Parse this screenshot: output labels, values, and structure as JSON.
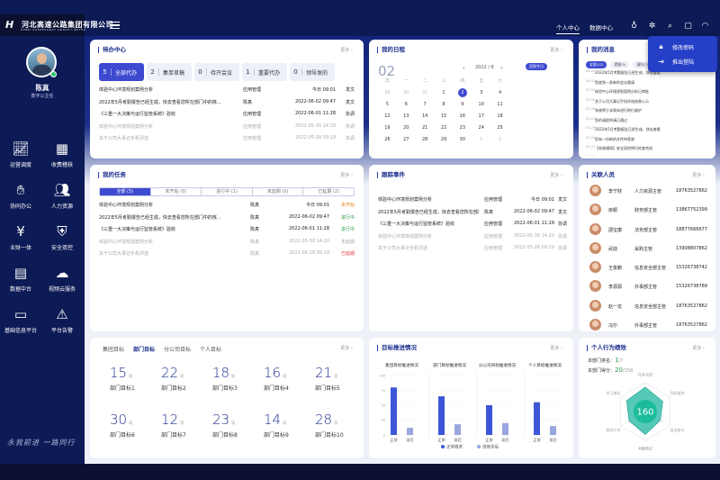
{
  "logo": {
    "name": "河北高速公路集团有限公司",
    "sub": "HEBEI EXPRESSWAY GROUP LIMITED"
  },
  "topnav": {
    "tabs": [
      "个人中心",
      "数据中心"
    ],
    "icons": [
      "bulb-icon",
      "apps-icon",
      "search-icon",
      "message-icon",
      "headset-icon",
      "gear-icon"
    ]
  },
  "user": {
    "name": "陈真",
    "role": "数字公主任"
  },
  "sidebar": {
    "items": [
      {
        "label": "运营调度",
        "icon": "chart-icon"
      },
      {
        "label": "收费稽核",
        "icon": "calculator-icon"
      },
      {
        "label": "协同办公",
        "icon": "handshake-icon"
      },
      {
        "label": "人力资源",
        "icon": "people-icon"
      },
      {
        "label": "业财一体",
        "icon": "money-icon"
      },
      {
        "label": "安全双控",
        "icon": "shield-icon"
      },
      {
        "label": "数据中台",
        "icon": "data-icon"
      },
      {
        "label": "视频云服务",
        "icon": "cloud-play-icon"
      },
      {
        "label": "基础信息平台",
        "icon": "folder-icon"
      },
      {
        "label": "平台告警",
        "icon": "alarm-icon"
      }
    ]
  },
  "signature": "永我前进 一路同行",
  "popup": {
    "items": [
      "修改密码",
      "推出登陆"
    ]
  },
  "todo": {
    "title": "待办中心",
    "more": "更多",
    "tabs": [
      {
        "num": "5",
        "label": "全部代办"
      },
      {
        "num": "2",
        "label": "集单草稿"
      },
      {
        "num": "0",
        "label": "待开会议"
      },
      {
        "num": "1",
        "label": "重要代办"
      },
      {
        "num": "0",
        "label": "领导发的"
      }
    ],
    "rows": [
      {
        "title": "体验中心环境规划案例分析",
        "sys": "应用管理",
        "date": "今日 09:01",
        "status": "发文",
        "dim": false
      },
      {
        "title": "2022年5月考勤报告已经生成，快去查看您所在部门中的核...",
        "sys": "陈真",
        "date": "2022-06-02 09:47",
        "status": "发文",
        "dim": false
      },
      {
        "title": "《三重一大决策与运行监管系统》验收",
        "sys": "应用管理",
        "date": "2022-06-01 11:28",
        "status": "协调",
        "dim": false
      },
      {
        "title": "体验中心环境规划案例分析",
        "sys": "应用管理",
        "date": "2022-05-30 14:20",
        "status": "协调",
        "dim": true
      },
      {
        "title": "关于公司大事记手机评选",
        "sys": "应用管理",
        "date": "2022-05-28 09:19",
        "status": "协调",
        "dim": true
      }
    ]
  },
  "calendar": {
    "title": "我的日程",
    "more": "更多",
    "day": "02",
    "month": "2022 / 6",
    "today_btn": "回到今日",
    "weekdays": [
      "日",
      "一",
      "二",
      "三",
      "四",
      "五",
      "六"
    ],
    "weeks": [
      [
        "29",
        "30",
        "31",
        "1",
        "2",
        "3",
        "4"
      ],
      [
        "5",
        "6",
        "7",
        "8",
        "9",
        "10",
        "11"
      ],
      [
        "12",
        "13",
        "14",
        "15",
        "16",
        "17",
        "18"
      ],
      [
        "19",
        "20",
        "21",
        "22",
        "23",
        "24",
        "25"
      ],
      [
        "26",
        "27",
        "28",
        "29",
        "30",
        "1",
        "2"
      ]
    ],
    "today": "2"
  },
  "messages": {
    "title": "我的消息",
    "more": "更多",
    "tabs": [
      "全部(12)",
      "提醒(5)",
      "通知(7)"
    ],
    "items": [
      {
        "date": "06-02",
        "text": "2022年5月考勤报告已经生成，快去查看"
      },
      {
        "date": "06-01",
        "text": "您收到一条新的会议邀请"
      },
      {
        "date": "05-30",
        "text": "体验中心环境规划案例分析已审批"
      },
      {
        "date": "05-30",
        "text": "关于公司大事记手机评选结果公示"
      },
      {
        "date": "05-28",
        "text": "系统将于本周末进行例行维护"
      },
      {
        "date": "05-27",
        "text": "您的请假申请已通过"
      },
      {
        "date": "05-26",
        "text": "2022年5月考勤报告已经生成，快去查看"
      },
      {
        "date": "05-25",
        "text": "您有一份新的文件待签收"
      },
      {
        "date": "05-24",
        "text": "【系统通知】安全双控例行检查完成"
      },
      {
        "date": "05-22",
        "text": "2022年第一季度绩效考核结果已发布"
      },
      {
        "date": "05-20",
        "text": "关于开展《三重一大决策与运行监管系统》培训"
      },
      {
        "date": "05-19",
        "text": "您的报销单已完成审批"
      }
    ]
  },
  "tasks": {
    "title": "我的任务",
    "more": "更多",
    "segs": [
      "全部 (5)",
      "未开始 (0)",
      "进行中 (1)",
      "未延期 (0)",
      "已延期 (2)"
    ],
    "rows": [
      {
        "title": "体验中心环境规划案例分析",
        "user": "陈真",
        "date": "今日 09:01",
        "status": "未开始",
        "color": "#e0891b",
        "dim": false
      },
      {
        "title": "2022年5月考勤报告已经生成，快去查看您所在部门中的核...",
        "user": "陈真",
        "date": "2022-06-02 09:47",
        "status": "进行中",
        "color": "#2c9b4b",
        "dim": false
      },
      {
        "title": "《三重一大决策与运行监管系统》验收",
        "user": "陈真",
        "date": "2022-06-01 11:28",
        "status": "进行中",
        "color": "#2c9b4b",
        "dim": false
      },
      {
        "title": "体验中心环境规划案例分析",
        "user": "陈真",
        "date": "2022-05-30 14:20",
        "status": "未延期",
        "color": "#888888",
        "dim": true
      },
      {
        "title": "关于公司大事记手机评选",
        "user": "陈真",
        "date": "2022-05-28 09:19",
        "status": "已延期",
        "color": "#e03a3a",
        "dim": true
      }
    ]
  },
  "tracking": {
    "title": "跟踪事件",
    "more": "更多",
    "rows": [
      {
        "title": "体验中心环境规划案例分析",
        "sys": "应用管理",
        "date": "今日 09:01",
        "status": "发文",
        "dim": false
      },
      {
        "title": "2022年5月考勤报告已经生成，快去查看您所在部门中的核...",
        "sys": "陈真",
        "date": "2022-06-02 09:47",
        "status": "发文",
        "dim": false
      },
      {
        "title": "《三重一大决策与运行监管系统》验收",
        "sys": "应用管理",
        "date": "2022-06-01 11:28",
        "status": "协调",
        "dim": false
      },
      {
        "title": "体验中心环境规划案例分析",
        "sys": "应用管理",
        "date": "2022-05-30 14:20",
        "status": "协调",
        "dim": true
      },
      {
        "title": "关于公司大事记手机评选",
        "sys": "应用管理",
        "date": "2022-05-28 09:19",
        "status": "协调",
        "dim": true
      }
    ]
  },
  "contacts": {
    "title": "关联人员",
    "more": "更多",
    "items": [
      {
        "name": "李宁财",
        "role": "人力资源主管",
        "phone": "18763527862"
      },
      {
        "name": "房颖",
        "role": "财务部主管",
        "phone": "13867752399"
      },
      {
        "name": "邵宝康",
        "role": "法务部主管",
        "phone": "18877666677"
      },
      {
        "name": "武勋",
        "role": "采购主管",
        "phone": "13908807862"
      },
      {
        "name": "王俊鹏",
        "role": "信息安全部主管",
        "phone": "15326738742"
      },
      {
        "name": "李源源",
        "role": "外事部主管",
        "phone": "15326738789"
      },
      {
        "name": "赵一龙",
        "role": "信息安全部主管",
        "phone": "18763527862"
      },
      {
        "name": "冯尔",
        "role": "外事部主管",
        "phone": "18763527862"
      }
    ]
  },
  "targets": {
    "more": "更多",
    "tabs": [
      "集团目标",
      "部门目标",
      "分公司目标",
      "个人目标"
    ],
    "unit": "项",
    "items": [
      {
        "value": "15",
        "label": "部门目标1"
      },
      {
        "value": "22",
        "label": "部门目标2"
      },
      {
        "value": "18",
        "label": "部门目标3"
      },
      {
        "value": "16",
        "label": "部门目标4"
      },
      {
        "value": "21",
        "label": "部门目标5"
      },
      {
        "value": "30",
        "label": "部门目标6"
      },
      {
        "value": "12",
        "label": "部门目标7"
      },
      {
        "value": "23",
        "label": "部门目标8"
      },
      {
        "value": "14",
        "label": "部门目标9"
      },
      {
        "value": "28",
        "label": "部门目标10"
      }
    ]
  },
  "progress": {
    "title": "目标推进情况",
    "more": "更多",
    "legend": [
      "正常推进",
      "进度滞后"
    ],
    "colors": {
      "normal": "#3d56d8",
      "lag": "#9aa7de"
    }
  },
  "chart_data": {
    "type": "bar",
    "categories": [
      "正常",
      "滞后"
    ],
    "series": [
      {
        "name": "集团目标推进情况",
        "values": [
          80,
          12
        ]
      },
      {
        "name": "部门目标推进情况",
        "values": [
          65,
          18
        ]
      },
      {
        "name": "分公司目标推进情况",
        "values": [
          50,
          20
        ]
      },
      {
        "name": "个人目标推进情况",
        "values": [
          55,
          15
        ]
      }
    ],
    "ylim": [
      0,
      100
    ],
    "legend": [
      "正常推进",
      "进度滞后"
    ]
  },
  "performance": {
    "title": "个人行为绩效",
    "more": "更多",
    "score_label1": "本部门排名：",
    "score1": "1",
    "score1_tail": "/7",
    "score_label2": "本部门得分：",
    "score2": "20",
    "score2_tail": "/158",
    "center": "160",
    "axes": [
      "任务完成",
      "目标推进",
      "会议参与",
      "考勤情况",
      "协同工作",
      "学习成长"
    ],
    "values": [
      0.85,
      0.7,
      0.6,
      0.8,
      0.65,
      0.75
    ]
  }
}
